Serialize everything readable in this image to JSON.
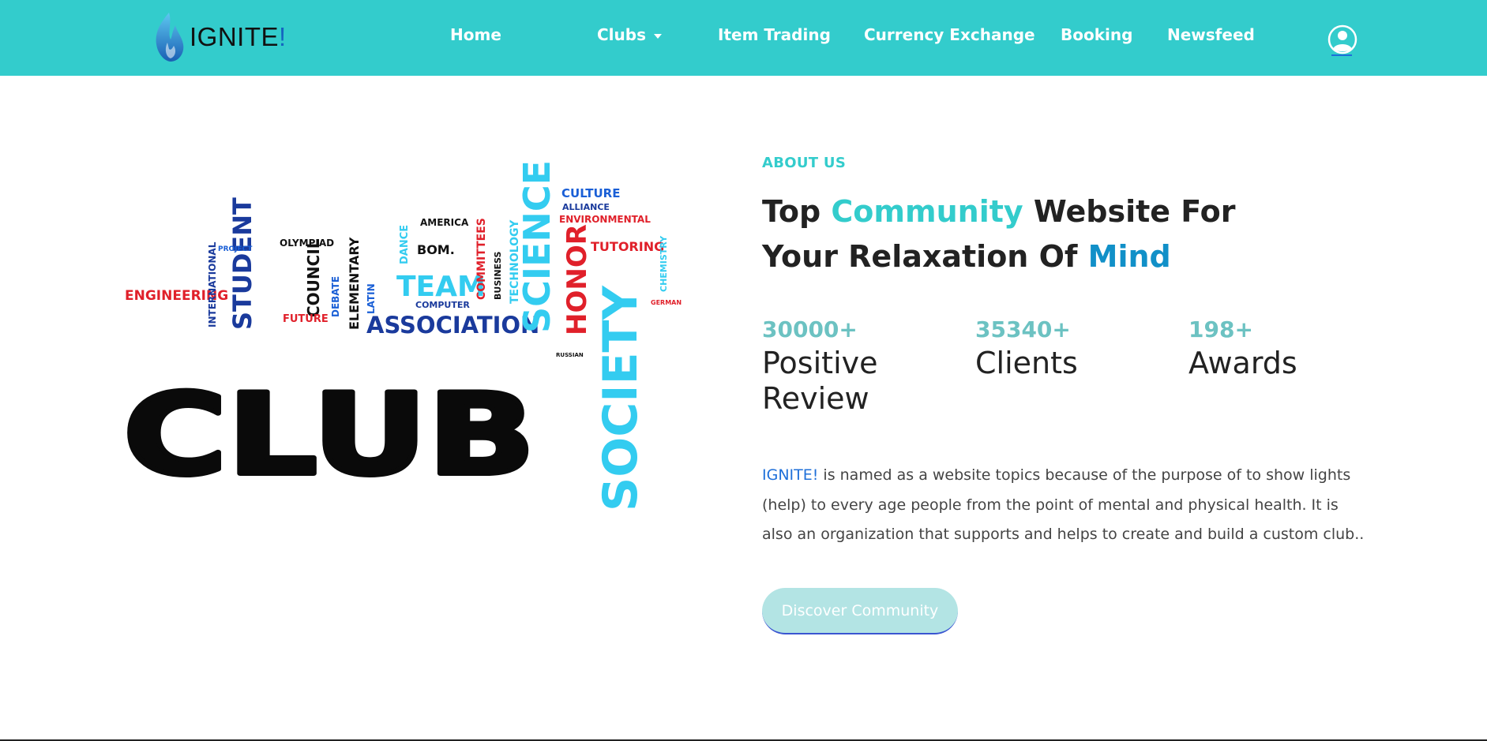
{
  "nav": {
    "brand": "IGNITE",
    "brand_mark": "!",
    "links": {
      "home": "Home",
      "clubs": "Clubs",
      "item_trading": "Item Trading",
      "currency_exchange": "Currency Exchange",
      "booking": "Booking",
      "newsfeed": "Newsfeed"
    },
    "user_icon": "user-circle-icon",
    "color": "#33cccc"
  },
  "hero_image": {
    "big_word": "CLUB",
    "side_word": "SOCIETY",
    "words": [
      "SCIENCE",
      "HONOR",
      "ASSOCIATION",
      "TEAM",
      "STUDENT",
      "ENGINEERING",
      "COUNCIL",
      "ELEMENTARY",
      "OLYMPIAD",
      "AMERICA",
      "BOM.",
      "COMMITTEES",
      "TECHNOLOGY",
      "BUSINESS",
      "CULTURE",
      "ALLIANCE",
      "ENVIRONMENTAL",
      "TUTORING",
      "CHEMISTRY",
      "INTERNATIONAL",
      "DEBATE",
      "FUTURE",
      "COMPUTER",
      "DANCE",
      "LATIN",
      "PROJECT",
      "RUSSIAN",
      "GERMAN"
    ]
  },
  "about": {
    "label": "ABOUT US",
    "headline": {
      "p1": "Top ",
      "p2": "Community",
      "p3": " Website For Your Relaxation Of ",
      "p4": "Mind"
    },
    "stats": [
      {
        "number": "30000+",
        "label": "Positive Review"
      },
      {
        "number": "35340+",
        "label": "Clients"
      },
      {
        "number": "198+",
        "label": "Awards"
      }
    ],
    "description": {
      "brand": "IGNITE!",
      "text": " is named as a website topics because of the purpose of to show lights (help) to every age people from the point of mental and physical health. It is also an organization that supports and helps to create and build a custom club.."
    },
    "cta": "Discover Community"
  },
  "colors": {
    "accent_teal": "#33cccc",
    "accent_blue": "#1190c8",
    "link_blue": "#1e6fd9"
  }
}
